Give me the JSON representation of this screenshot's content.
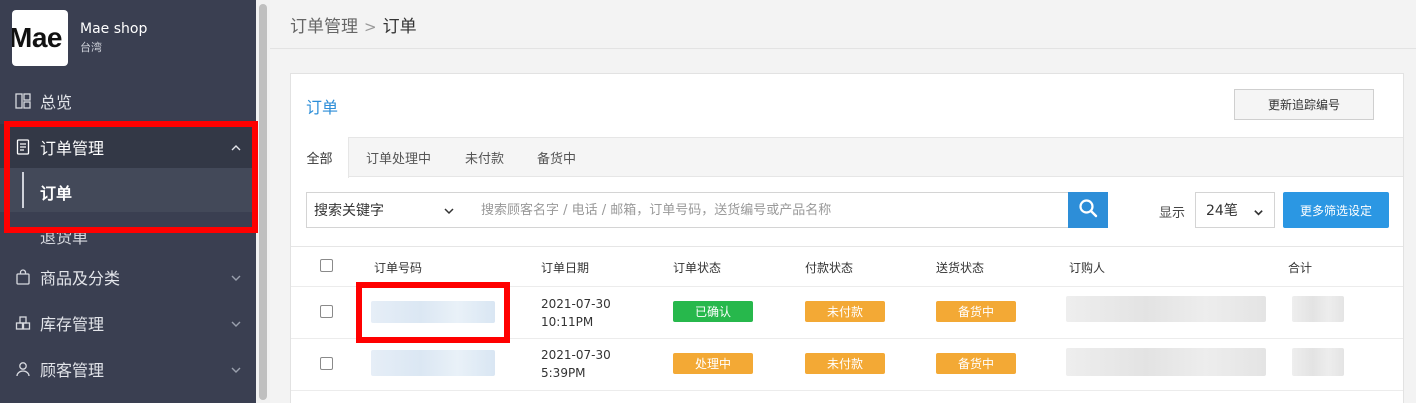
{
  "shop": {
    "logo_text": "Mae",
    "name": "Mae shop",
    "region": "台湾"
  },
  "sidebar": {
    "items": [
      {
        "label": "总览",
        "icon": "dashboard-icon"
      },
      {
        "label": "订单管理",
        "icon": "document-icon",
        "expanded": true
      },
      {
        "label": "商品及分类",
        "icon": "bag-icon"
      },
      {
        "label": "库存管理",
        "icon": "inventory-icon"
      },
      {
        "label": "顾客管理",
        "icon": "user-icon"
      }
    ],
    "sub_items": [
      {
        "label": "订单",
        "active": true
      },
      {
        "label": "退货单",
        "active": false
      }
    ]
  },
  "breadcrumb": {
    "parent": "订单管理",
    "separator": ">",
    "current": "订单"
  },
  "panel": {
    "title": "订单",
    "update_tracking_button": "更新追踪编号"
  },
  "tabs": [
    "全部",
    "订单处理中",
    "未付款",
    "备货中"
  ],
  "search": {
    "field_select": "搜索关键字",
    "placeholder": "搜索顾客名字 / 电话 / 邮箱，订单号码，送货编号或产品名称",
    "show_label": "显示",
    "page_size": "24笔",
    "more_filters_button": "更多筛选设定"
  },
  "table": {
    "columns": [
      "订单号码",
      "订单日期",
      "订单状态",
      "付款状态",
      "送货状态",
      "订购人",
      "合计"
    ],
    "rows": [
      {
        "date": "2021-07-30",
        "time": "10:11PM",
        "order_status": "已确认",
        "payment_status": "未付款",
        "delivery_status": "备货中"
      },
      {
        "date": "2021-07-30",
        "time": "5:39PM",
        "order_status": "处理中",
        "payment_status": "未付款",
        "delivery_status": "备货中"
      }
    ]
  },
  "colors": {
    "sidebar_bg": "#3a3f51",
    "accent": "#2d8ed8",
    "status_green": "#27b84c",
    "status_orange": "#f3a935",
    "highlight_red": "#ff0000"
  }
}
